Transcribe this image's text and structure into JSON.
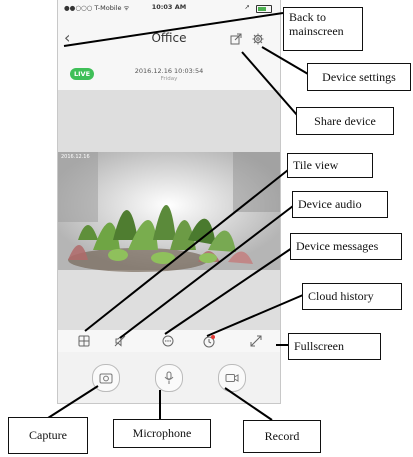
{
  "status_bar": {
    "carrier": "●●○○○ T-Mobile ᯤ",
    "time": "10:03 AM",
    "location": "➚"
  },
  "header": {
    "title": "Office"
  },
  "live_badge": "LIVE",
  "timestamp": {
    "datetime": "2016.12.16  10:03:54",
    "day": "Friday"
  },
  "video_overlay": "2016.12.16",
  "callouts": {
    "back": "Back to\nmainscreen",
    "device_settings": "Device settings",
    "share_device": "Share device",
    "tile_view": "Tile view",
    "device_audio": "Device audio",
    "device_messages": "Device messages",
    "cloud_history": "Cloud history",
    "fullscreen": "Fullscreen",
    "capture": "Capture",
    "microphone": "Microphone",
    "record": "Record"
  },
  "icons": {
    "back": "chevron-left",
    "share": "share",
    "settings": "gear",
    "tile": "tile-grid",
    "audio": "speaker-muted",
    "messages": "chat-bubble",
    "cloud": "cloud-history",
    "fullscreen": "expand",
    "capture": "camera",
    "microphone": "microphone",
    "record": "video-camera"
  },
  "colors": {
    "live": "#3fbf58",
    "cloud_dot": "#e53935"
  }
}
